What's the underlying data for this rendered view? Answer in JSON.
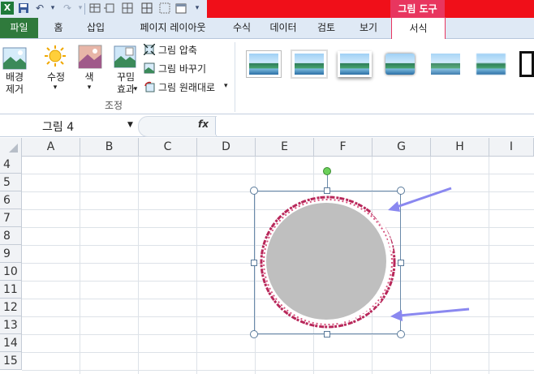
{
  "window": {
    "context_tool": "그림 도구"
  },
  "tabs": [
    {
      "label": "파일"
    },
    {
      "label": "홈"
    },
    {
      "label": "삽입"
    },
    {
      "label": "페이지 레이아웃"
    },
    {
      "label": "수식"
    },
    {
      "label": "데이터"
    },
    {
      "label": "검토"
    },
    {
      "label": "보기"
    },
    {
      "label": "서식"
    }
  ],
  "ribbon": {
    "remove_background": "배경\n제거",
    "corrections": "수정",
    "color": "색",
    "artistic_effects": "꾸밈\n효과",
    "compress": "그림 압축",
    "change_picture": "그림 바꾸기",
    "reset_picture": "그림 원래대로",
    "group_adjust": "조정"
  },
  "formula_bar": {
    "name_box": "그림 4",
    "fx": "fx",
    "value": ""
  },
  "columns": [
    "A",
    "B",
    "C",
    "D",
    "E",
    "F",
    "G",
    "H",
    "I"
  ],
  "rows": [
    "4",
    "5",
    "6",
    "7",
    "8",
    "9",
    "10",
    "11",
    "12",
    "13",
    "14",
    "15"
  ],
  "colors": {
    "accent_context": "#e8365f",
    "file_tab": "#2f7a3c",
    "red_bar": "#f00f19",
    "arrow": "#8a88f0"
  },
  "icons": [
    "excel-icon",
    "save-icon",
    "undo-icon",
    "redo-icon",
    "dropdown-icon"
  ]
}
